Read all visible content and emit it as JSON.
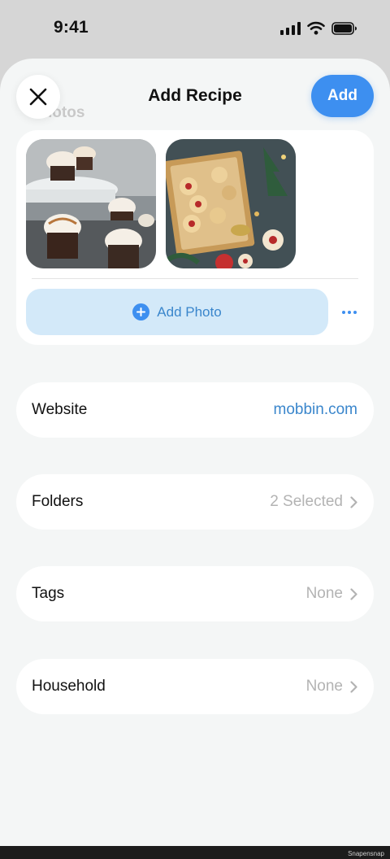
{
  "status": {
    "time": "9:41"
  },
  "header": {
    "title": "Add Recipe",
    "add_label": "Add"
  },
  "photos": {
    "section_label": "Photos",
    "add_photo_label": "Add Photo"
  },
  "rows": [
    {
      "label": "Website",
      "value": "mobbin.com"
    },
    {
      "label": "Folders",
      "value": "2 Selected"
    },
    {
      "label": "Tags",
      "value": "None"
    },
    {
      "label": "Household",
      "value": "None"
    }
  ],
  "watermark": "Snapensnap",
  "colors": {
    "accent": "#3d8ff0",
    "accent_soft": "#d3e9f9",
    "link": "#3a86cc",
    "sheet_bg": "#f4f6f6"
  }
}
